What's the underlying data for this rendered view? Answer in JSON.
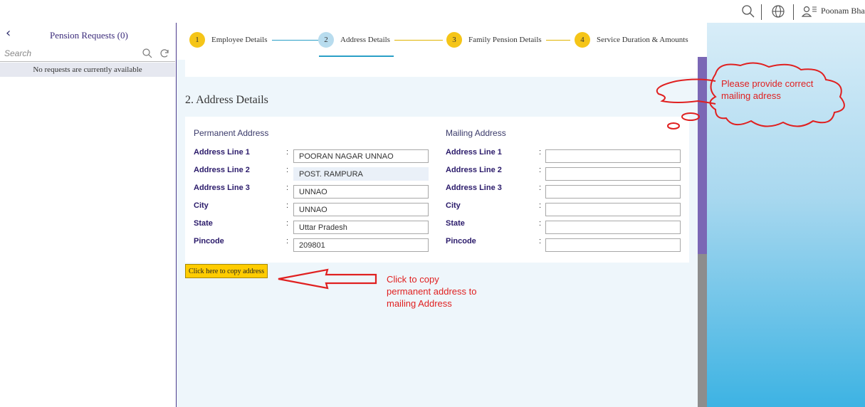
{
  "topbar": {
    "user_name": "Poonam Bhart",
    "icons": [
      "search-icon",
      "globe-icon",
      "user-menu-icon"
    ]
  },
  "left_panel": {
    "title": "Pension Requests (0)",
    "search_placeholder": "Search",
    "empty_message": "No requests are currently available"
  },
  "steps": [
    {
      "num": "1",
      "label": "Employee Details",
      "state": "done",
      "color": "#f5c518"
    },
    {
      "num": "2",
      "label": "Address Details",
      "state": "active",
      "color": "#b8dcee"
    },
    {
      "num": "3",
      "label": "Family Pension Details",
      "state": "pending",
      "color": "#f5c518"
    },
    {
      "num": "4",
      "label": "Service Duration & Amounts",
      "state": "pending",
      "color": "#f5c518"
    }
  ],
  "section": {
    "title": "2. Address Details"
  },
  "permanent": {
    "heading": "Permanent Address",
    "fields": [
      {
        "label": "Address Line 1",
        "value": "POORAN NAGAR UNNAO"
      },
      {
        "label": "Address Line 2",
        "value": "POST. RAMPURA"
      },
      {
        "label": "Address Line 3",
        "value": "UNNAO"
      },
      {
        "label": "City",
        "value": "UNNAO"
      },
      {
        "label": "State",
        "value": "Uttar Pradesh"
      },
      {
        "label": "Pincode",
        "value": "209801"
      }
    ]
  },
  "mailing": {
    "heading": "Mailing Address",
    "fields": [
      {
        "label": "Address Line 1",
        "value": ""
      },
      {
        "label": "Address Line 2",
        "value": ""
      },
      {
        "label": "Address Line 3",
        "value": ""
      },
      {
        "label": "City",
        "value": ""
      },
      {
        "label": "State",
        "value": ""
      },
      {
        "label": "Pincode",
        "value": ""
      }
    ]
  },
  "copy_button": {
    "label": "Click here to copy address"
  },
  "annotations": {
    "cloud_text_1": "Please provide correct",
    "cloud_text_2": "mailing adress",
    "arrow_text_1": "Click to copy",
    "arrow_text_2": "permanent address to",
    "arrow_text_3": "mailing Address"
  },
  "colors": {
    "accent": "#4b3a8c",
    "step_yellow": "#f5c518",
    "step_active": "#b8dcee",
    "annotation_red": "#e02020",
    "button_yellow": "#ffcc00"
  }
}
